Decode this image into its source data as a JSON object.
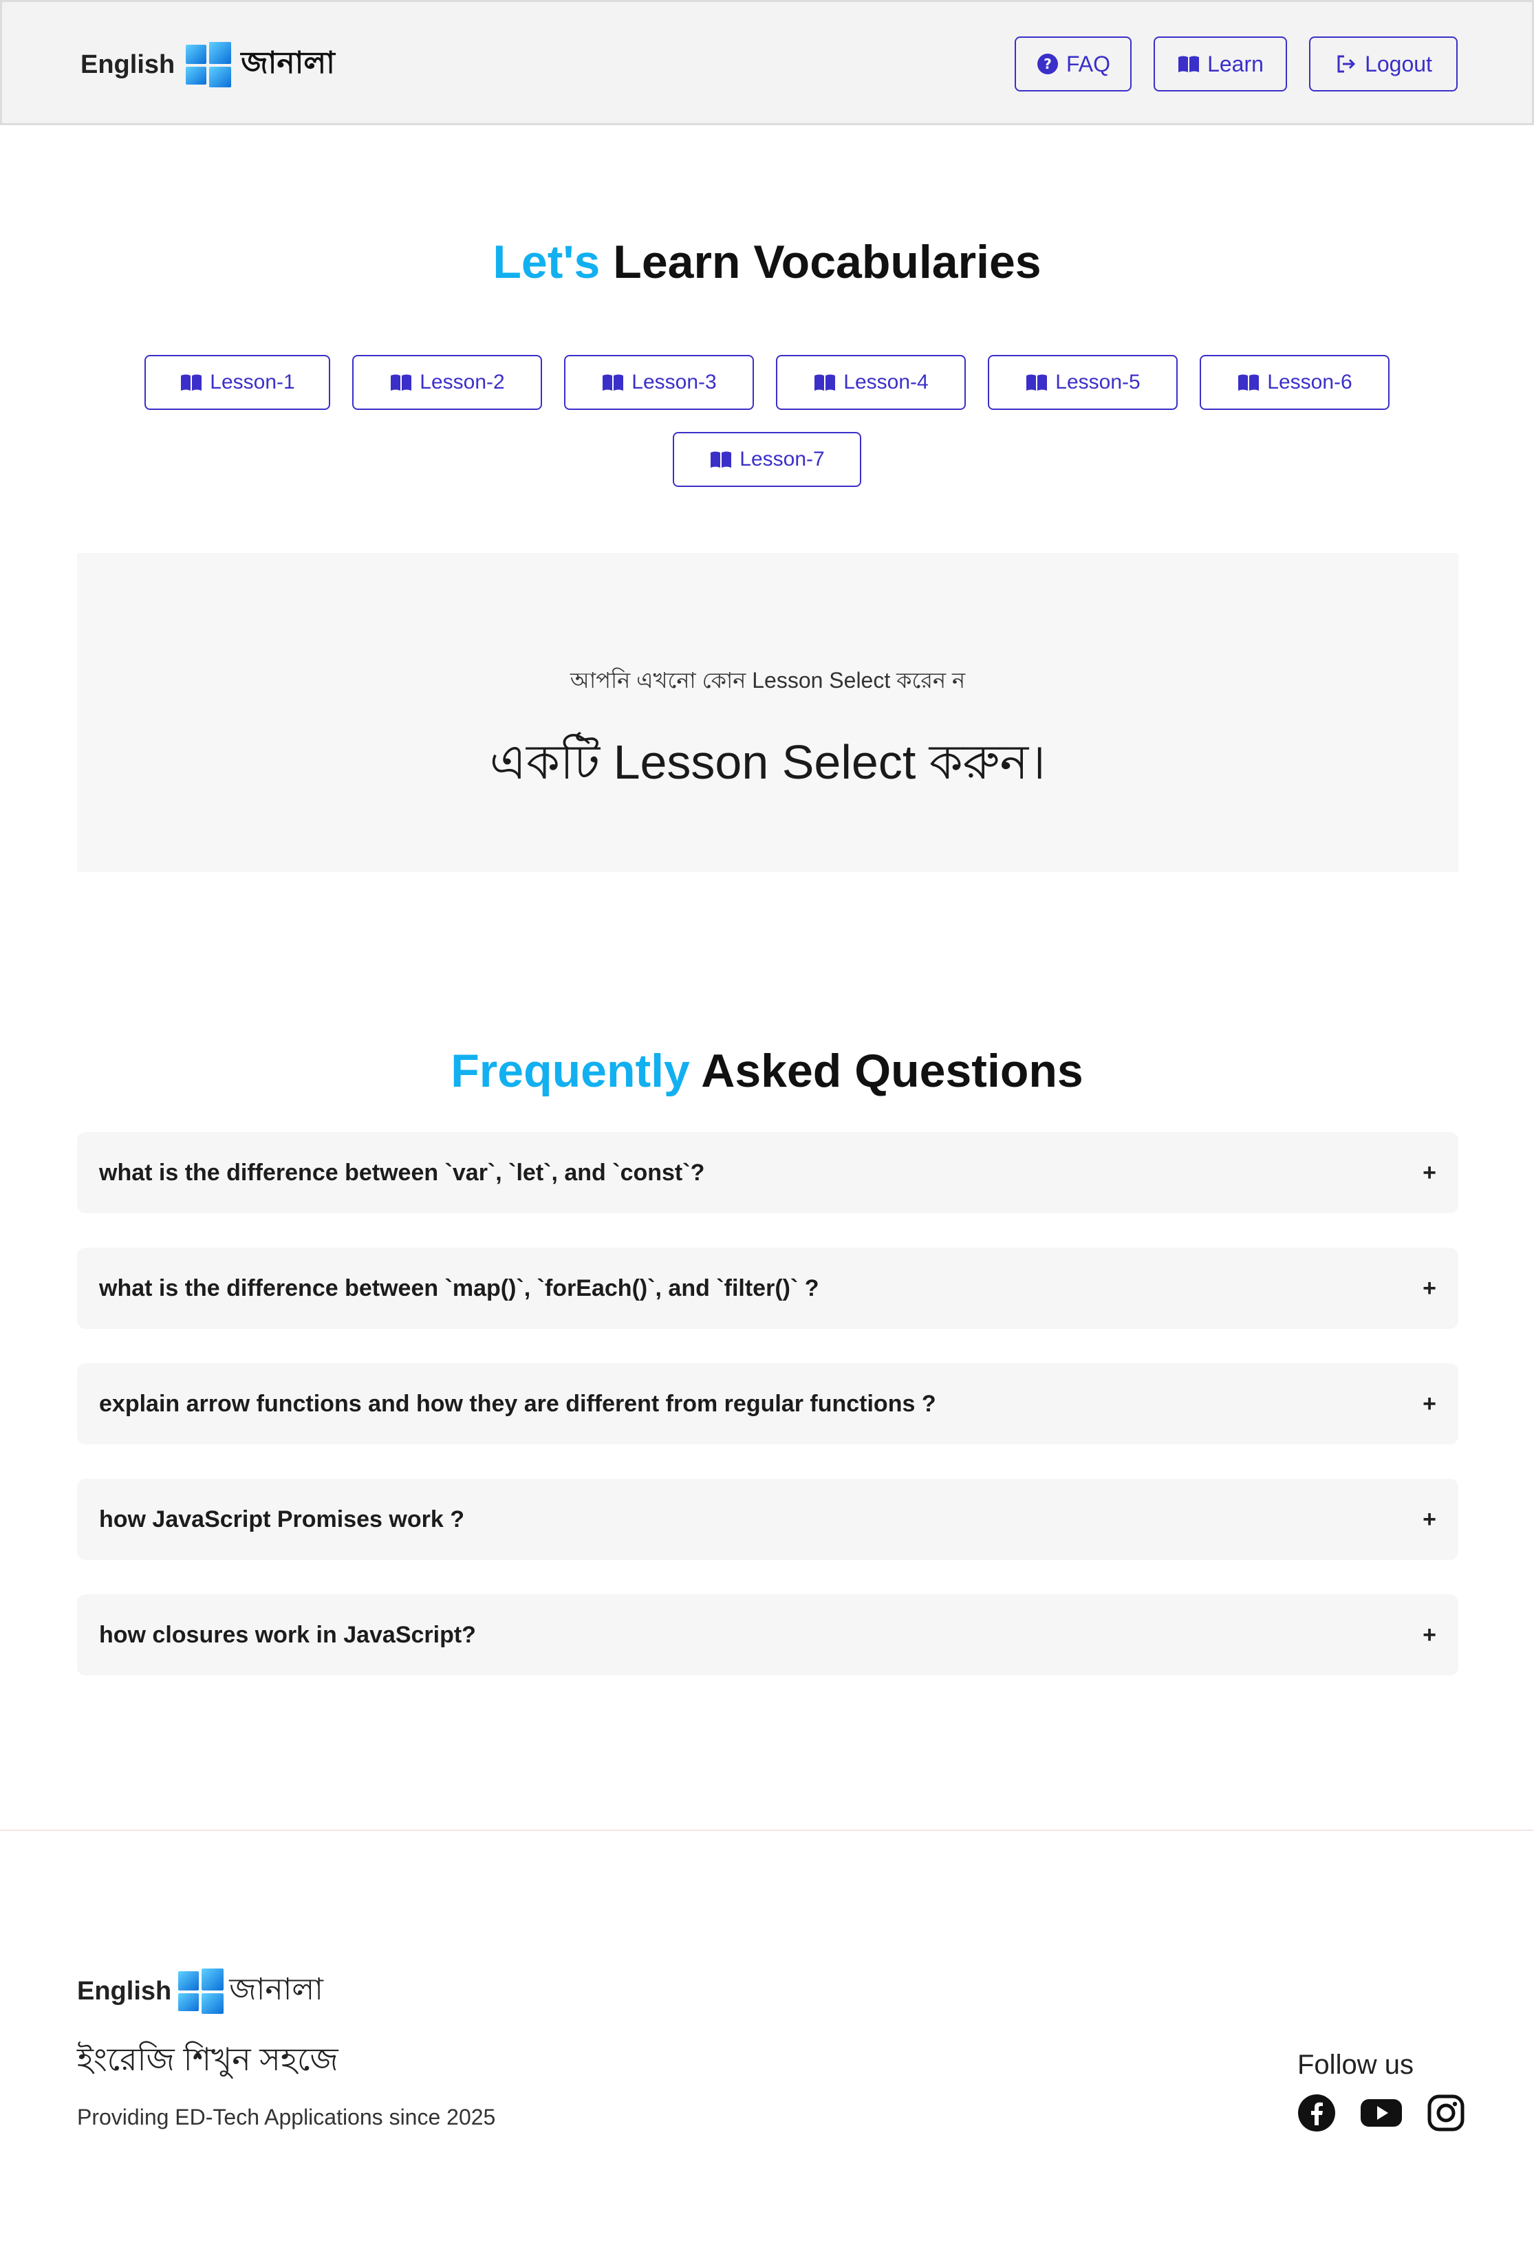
{
  "navbar": {
    "brand_en": "English",
    "brand_bn": "জানালা",
    "faq_label": "FAQ",
    "learn_label": "Learn",
    "logout_label": "Logout"
  },
  "vocab": {
    "title_highlight": "Let's",
    "title_rest": "Learn Vocabularies",
    "lessons": [
      "Lesson-1",
      "Lesson-2",
      "Lesson-3",
      "Lesson-4",
      "Lesson-5",
      "Lesson-6",
      "Lesson-7"
    ],
    "placeholder_small": "আপনি এখনো কোন Lesson Select করেন ন",
    "placeholder_big": "একটি Lesson Select করুন।"
  },
  "faq": {
    "title_highlight": "Frequently",
    "title_rest": "Asked Questions",
    "questions": [
      "what is the difference between `var`, `let`, and `const`?",
      "what is the difference between `map()`, `forEach()`, and `filter()` ?",
      "explain arrow functions and how they are different from regular functions ?",
      "how JavaScript Promises work ?",
      "how closures work in JavaScript?"
    ],
    "expand_symbol": "+"
  },
  "footer": {
    "brand_en": "English",
    "brand_bn": "জানালা",
    "tagline": "ইংরেজি শিখুন সহজে",
    "since": "Providing ED-Tech Applications since 2025",
    "follow_label": "Follow us",
    "socials": [
      "facebook-icon",
      "youtube-icon",
      "instagram-icon"
    ]
  },
  "colors": {
    "accent": "#3b2fc9",
    "highlight": "#12b0f0",
    "navbar_bg": "#f3f3f3",
    "card_bg": "#f6f6f6"
  }
}
